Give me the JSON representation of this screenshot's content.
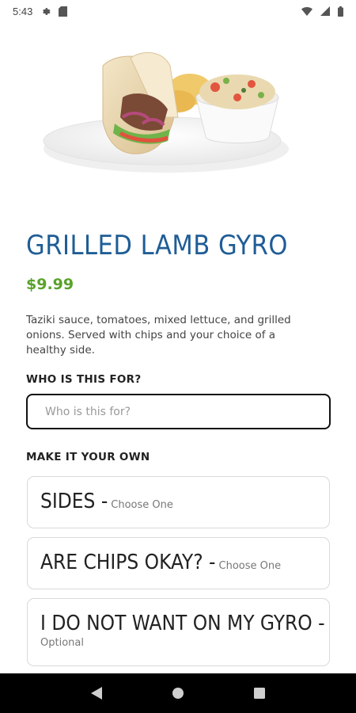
{
  "status_bar": {
    "time": "5:43",
    "icons": [
      "gear-icon",
      "sd-card-icon",
      "wifi-icon",
      "signal-icon",
      "battery-icon"
    ]
  },
  "product": {
    "title": "GRILLED LAMB GYRO",
    "price": "$9.99",
    "description": "Taziki sauce, tomatoes, mixed lettuce, and grilled onions.  Served with chips and your choice of a healthy side.",
    "image": "gyro-plate-photo"
  },
  "who_for": {
    "label": "WHO IS THIS FOR?",
    "placeholder": "Who is this for?",
    "value": ""
  },
  "customize": {
    "label": "MAKE IT YOUR OWN",
    "options": [
      {
        "title": "SIDES - ",
        "hint": "Choose One"
      },
      {
        "title": "ARE CHIPS OKAY? - ",
        "hint": "Choose One"
      },
      {
        "title": "I DO NOT WANT ON MY GYRO - ",
        "hint": "Optional"
      }
    ]
  },
  "nav_bar": {
    "buttons": [
      "back-icon",
      "home-icon",
      "recents-icon"
    ]
  },
  "colors": {
    "title": "#1f5d96",
    "price": "#5aa22b",
    "nav_bar": "#000000"
  }
}
